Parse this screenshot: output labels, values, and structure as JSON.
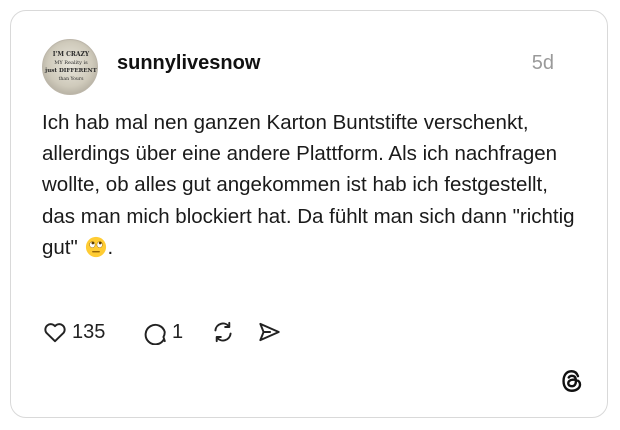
{
  "post": {
    "username": "sunnylivesnow",
    "timestamp": "5d",
    "text": "Ich hab mal nen ganzen Karton Buntstifte verschenkt, allerdings über eine andere Plattform. Als ich nachfragen wollte, ob alles gut angekommen ist hab ich festgestellt, das man mich blockiert hat. Da fühlt man sich dann \"richtig gut\"",
    "text_suffix": ".",
    "emoji": "face-with-rolling-eyes",
    "avatar_text": [
      "I'M CRAZY",
      "MY Reality is",
      "just DIFFERENT",
      "than Yours"
    ]
  },
  "actions": {
    "likes": "135",
    "replies": "1",
    "like_icon": "heart-icon",
    "reply_icon": "comment-bubble-icon",
    "repost_icon": "repost-icon",
    "share_icon": "send-icon"
  },
  "brand": {
    "logo": "threads-logo-icon"
  }
}
